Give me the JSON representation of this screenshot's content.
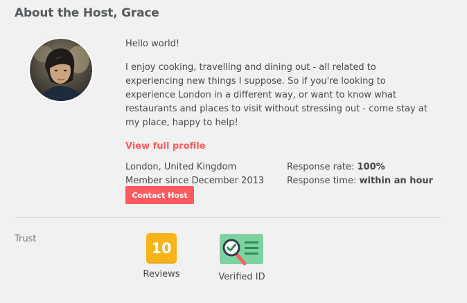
{
  "host_section": {
    "title": "About the Host, Grace",
    "greeting": "Hello world!",
    "bio": "I enjoy cooking, travelling and dining out - all related to experiencing new things I suppose. So if you're looking to experience London in a different way, or want to know what restaurants and places to visit without stressing out - come stay at my place, happy to help!",
    "view_profile_label": "View full profile",
    "location": "London, United Kingdom",
    "member_since": "Member since December 2013",
    "response_rate_label": "Response rate:",
    "response_rate_value": "100%",
    "response_time_label": "Response time:",
    "response_time_value": "within an hour",
    "contact_button_label": "Contact Host"
  },
  "trust": {
    "label": "Trust",
    "reviews_count": "10",
    "reviews_label": "Reviews",
    "verified_label": "Verified ID",
    "verified_icon": "verified-id-icon"
  },
  "colors": {
    "accent": "#ff5a5f",
    "reviews_badge": "#f7b318",
    "verified_green": "#7dd3a0",
    "background": "#f1f1f1"
  }
}
